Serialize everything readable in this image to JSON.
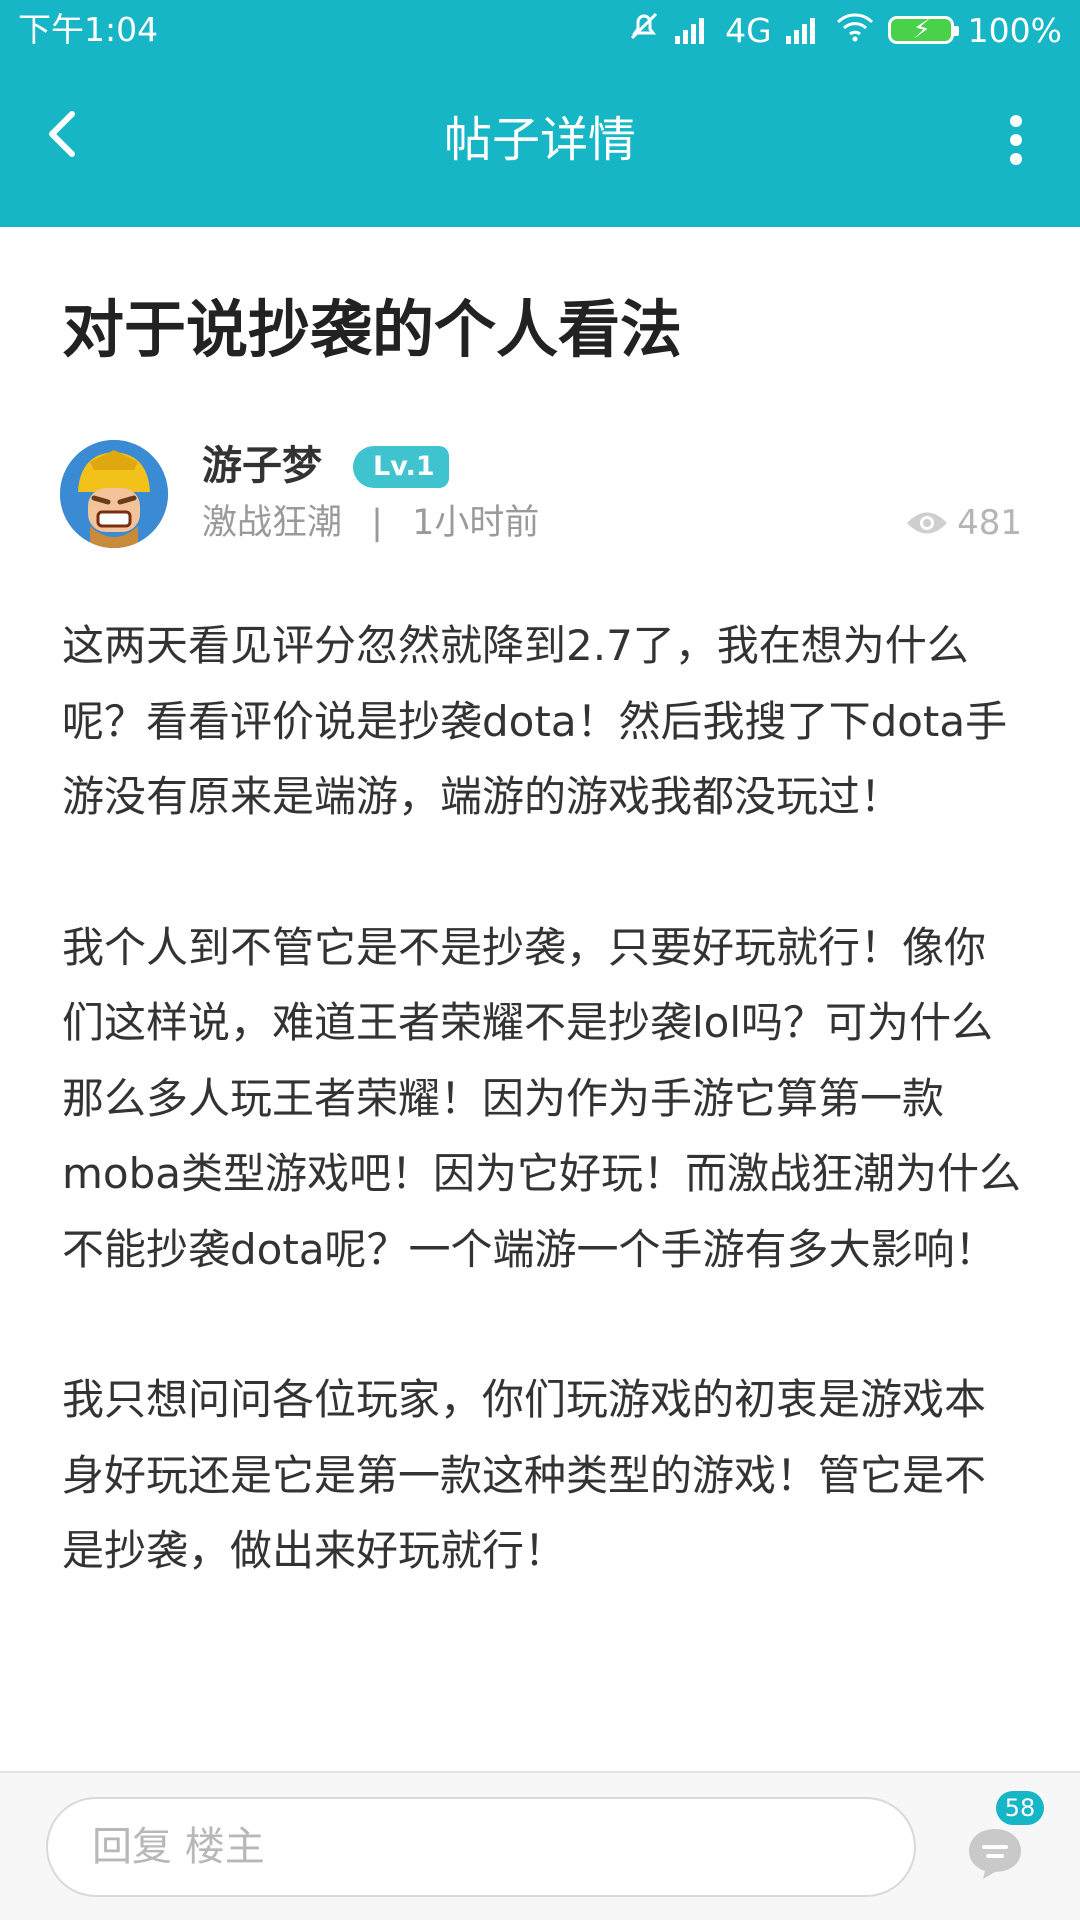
{
  "status_bar": {
    "time": "下午1:04",
    "network": "4G",
    "battery": "100%"
  },
  "header": {
    "title": "帖子详情",
    "back_icon": "chevron-left-icon",
    "more_icon": "more-vertical-icon"
  },
  "post": {
    "title": "对于说抄袭的个人看法",
    "author": {
      "name": "游子梦",
      "level": "Lv.1",
      "game": "激战狂潮",
      "separator": "|",
      "time": "1小时前"
    },
    "views": "481",
    "paragraphs": [
      "这两天看见评分忽然就降到2.7了，我在想为什么呢？看看评价说是抄袭dota！然后我搜了下dota手游没有原来是端游，端游的游戏我都没玩过！",
      "我个人到不管它是不是抄袭，只要好玩就行！像你们这样说，难道王者荣耀不是抄袭lol吗？可为什么那么多人玩王者荣耀！因为作为手游它算第一款moba类型游戏吧！因为它好玩！而激战狂潮为什么不能抄袭dota呢？一个端游一个手游有多大影响！",
      "我只想问问各位玩家，你们玩游戏的初衷是游戏本身好玩还是它是第一款这种类型的游戏！管它是不是抄袭，做出来好玩就行！"
    ]
  },
  "reply_bar": {
    "placeholder": "回复  楼主",
    "comment_count": "58"
  },
  "colors": {
    "primary": "#17b6c6",
    "badge": "#3fc3cf"
  }
}
